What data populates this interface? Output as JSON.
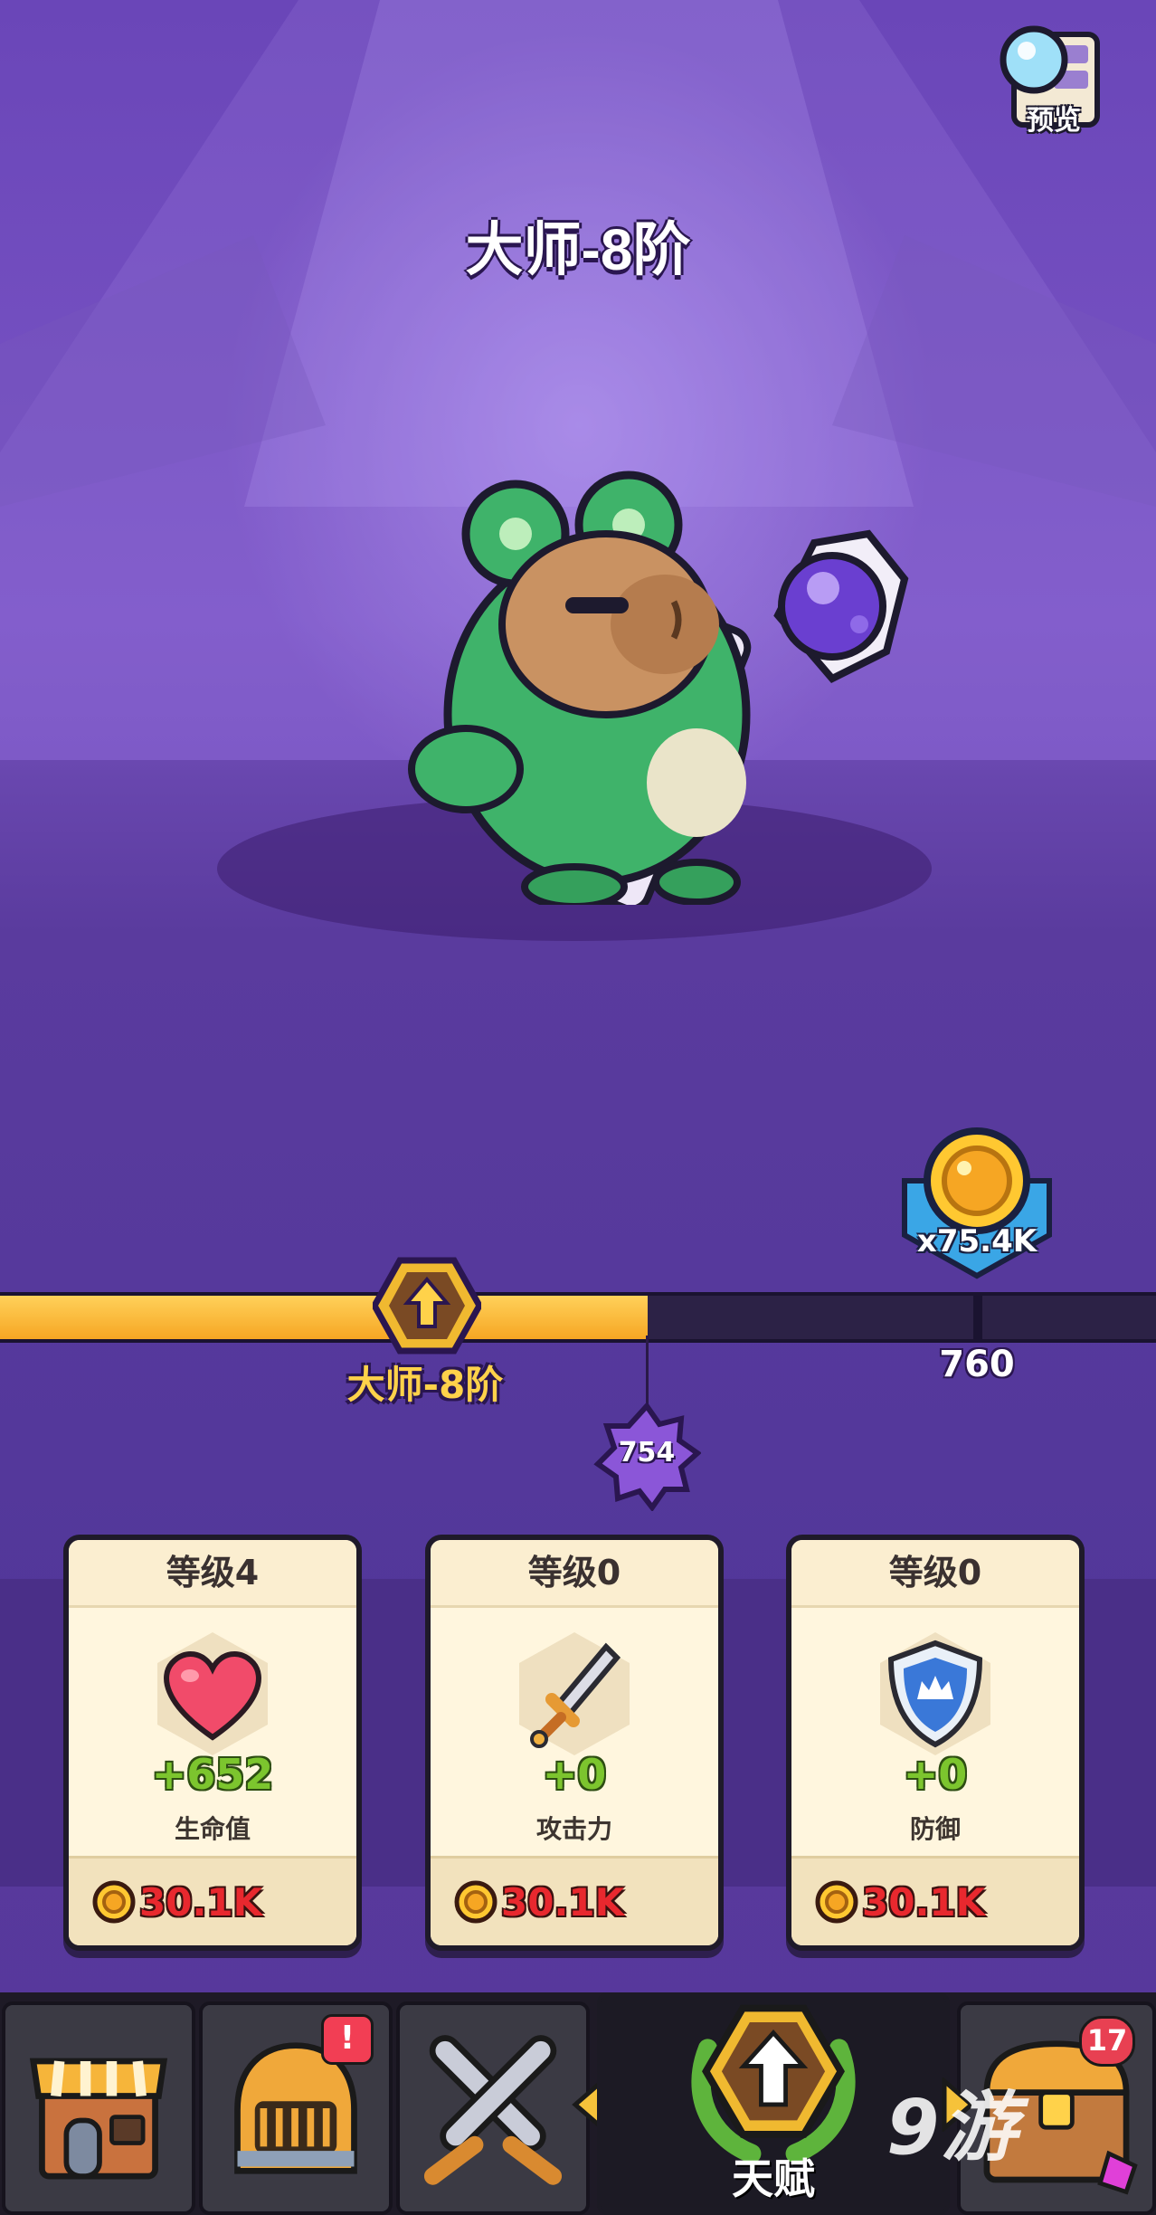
{
  "header": {
    "title": "大师-8阶",
    "preview_label": "预览"
  },
  "progress": {
    "reward_amount": "x75.4K",
    "current_rank_label": "大师-8阶",
    "next_milestone": "760",
    "current_level": "754",
    "fill_fraction": 0.56
  },
  "cards": [
    {
      "level": "等级4",
      "icon": "heart-icon",
      "value": "+652",
      "stat": "生命值",
      "cost": "30.1K"
    },
    {
      "level": "等级0",
      "icon": "sword-icon",
      "value": "+0",
      "stat": "攻击力",
      "cost": "30.1K"
    },
    {
      "level": "等级0",
      "icon": "shield-icon",
      "value": "+0",
      "stat": "防御",
      "cost": "30.1K"
    }
  ],
  "nav": {
    "tabs": [
      {
        "name": "shop",
        "icon": "shop-icon"
      },
      {
        "name": "equipment",
        "icon": "helmet-icon",
        "alert": "!"
      },
      {
        "name": "battle",
        "icon": "crossed-swords-icon"
      },
      {
        "name": "talent",
        "icon": "upgrade-arrow-icon",
        "label": "天赋",
        "active": true
      },
      {
        "name": "chest",
        "icon": "chest-icon",
        "count": "17"
      }
    ]
  },
  "watermark": "9游",
  "colors": {
    "accent_gold": "#f6a623",
    "stat_green": "#7cc52e",
    "cost_red": "#e8282e",
    "background_purple": "#5a3a98"
  }
}
